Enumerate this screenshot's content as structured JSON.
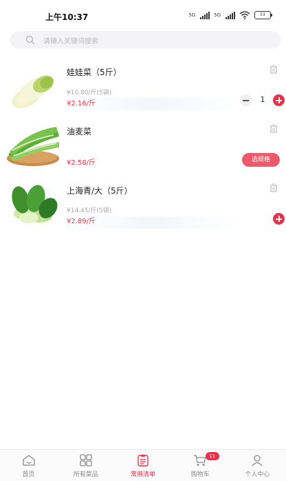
{
  "status_bar": {
    "time": "上午10:37",
    "signal_1": "5G",
    "signal_2": "5G",
    "battery": "53"
  },
  "search": {
    "placeholder": "请输入关键词搜索"
  },
  "products": [
    {
      "name": "娃娃菜（5斤）",
      "unit_price": "¥10.80/斤(5袋)",
      "price": "¥2.16/斤",
      "quantity": "1"
    },
    {
      "name": "油麦菜",
      "price": "¥2.58/斤",
      "spec_button": "选规格"
    },
    {
      "name": "上海青/大（5斤）",
      "unit_price": "¥14.45/斤(5袋)",
      "price": "¥2.89/斤"
    }
  ],
  "tabbar": {
    "items": [
      {
        "label": "首页",
        "icon": "home-icon"
      },
      {
        "label": "所有菜品",
        "icon": "grid-icon"
      },
      {
        "label": "常用清单",
        "icon": "clipboard-icon",
        "active": true
      },
      {
        "label": "购物车",
        "icon": "cart-icon",
        "badge": "11"
      },
      {
        "label": "个人中心",
        "icon": "user-icon"
      }
    ]
  },
  "colors": {
    "accent": "#e8334a",
    "spec_button": "#ee5a6a"
  }
}
